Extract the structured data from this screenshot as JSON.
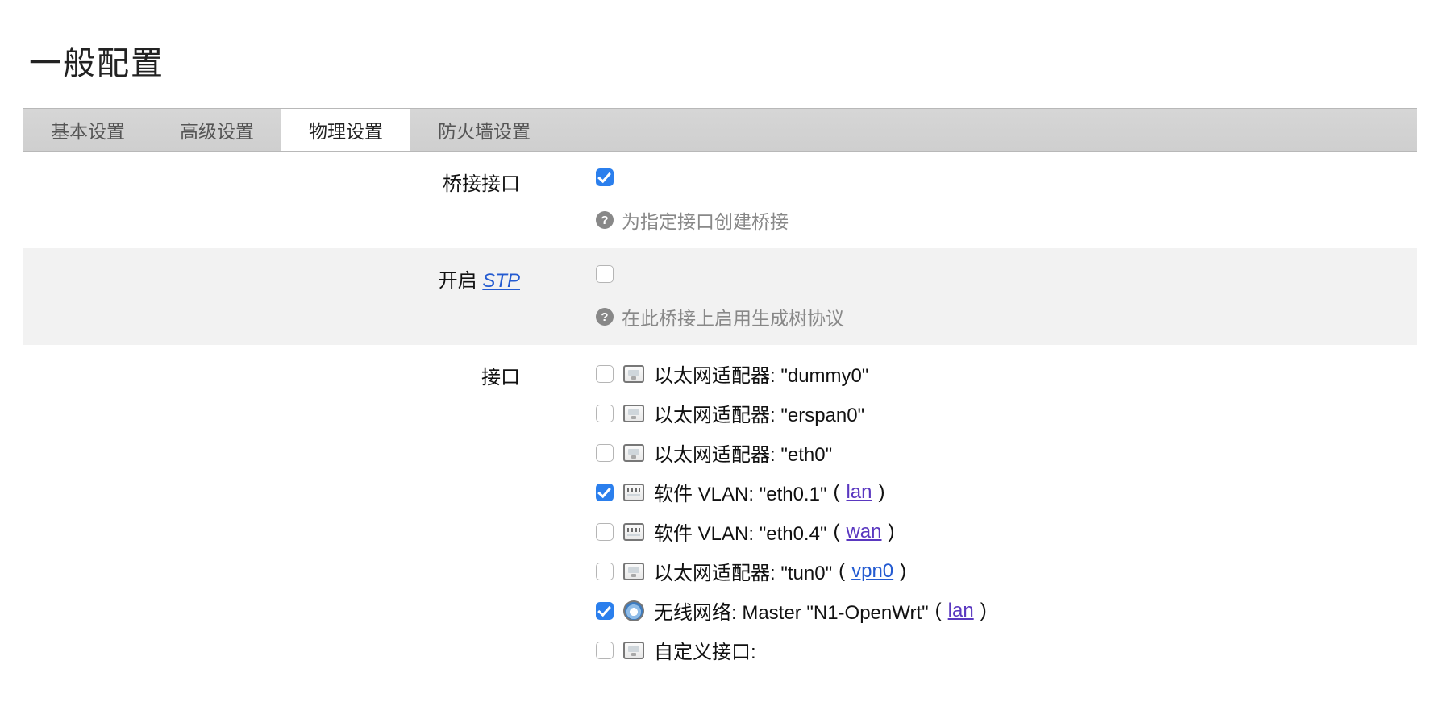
{
  "title": "一般配置",
  "tabs": [
    {
      "label": "基本设置",
      "active": false
    },
    {
      "label": "高级设置",
      "active": false
    },
    {
      "label": "物理设置",
      "active": true
    },
    {
      "label": "防火墙设置",
      "active": false
    }
  ],
  "fields": {
    "bridge": {
      "label": "桥接接口",
      "checked": true,
      "help": "为指定接口创建桥接"
    },
    "stp": {
      "label_prefix": "开启 ",
      "label_link": "STP",
      "checked": false,
      "help": "在此桥接上启用生成树协议"
    },
    "iface": {
      "label": "接口",
      "items": [
        {
          "checked": false,
          "icon": "eth",
          "text": "以太网适配器: \"dummy0\"",
          "zone": null
        },
        {
          "checked": false,
          "icon": "eth",
          "text": "以太网适配器: \"erspan0\"",
          "zone": null
        },
        {
          "checked": false,
          "icon": "eth",
          "text": "以太网适配器: \"eth0\"",
          "zone": null
        },
        {
          "checked": true,
          "icon": "vlan",
          "text": "软件 VLAN: \"eth0.1\"",
          "zone": "lan"
        },
        {
          "checked": false,
          "icon": "vlan",
          "text": "软件 VLAN: \"eth0.4\"",
          "zone": "wan"
        },
        {
          "checked": false,
          "icon": "eth",
          "text": "以太网适配器: \"tun0\"",
          "zone": "vpn0"
        },
        {
          "checked": true,
          "icon": "wifi",
          "text": "无线网络: Master \"N1-OpenWrt\"",
          "zone": "lan"
        },
        {
          "checked": false,
          "icon": "eth",
          "text": "自定义接口:",
          "zone": null
        }
      ]
    }
  },
  "zone_colors": {
    "lan": "purple",
    "wan": "purple",
    "vpn0": "blue"
  }
}
